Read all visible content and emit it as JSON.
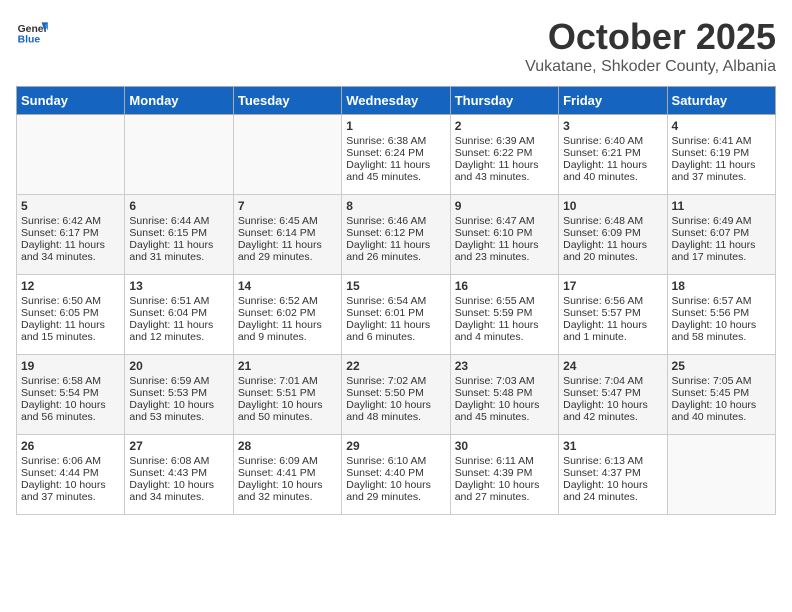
{
  "header": {
    "logo_general": "General",
    "logo_blue": "Blue",
    "month": "October 2025",
    "location": "Vukatane, Shkoder County, Albania"
  },
  "weekdays": [
    "Sunday",
    "Monday",
    "Tuesday",
    "Wednesday",
    "Thursday",
    "Friday",
    "Saturday"
  ],
  "rows": [
    [
      {
        "day": "",
        "info": ""
      },
      {
        "day": "",
        "info": ""
      },
      {
        "day": "",
        "info": ""
      },
      {
        "day": "1",
        "info": "Sunrise: 6:38 AM\nSunset: 6:24 PM\nDaylight: 11 hours and 45 minutes."
      },
      {
        "day": "2",
        "info": "Sunrise: 6:39 AM\nSunset: 6:22 PM\nDaylight: 11 hours and 43 minutes."
      },
      {
        "day": "3",
        "info": "Sunrise: 6:40 AM\nSunset: 6:21 PM\nDaylight: 11 hours and 40 minutes."
      },
      {
        "day": "4",
        "info": "Sunrise: 6:41 AM\nSunset: 6:19 PM\nDaylight: 11 hours and 37 minutes."
      }
    ],
    [
      {
        "day": "5",
        "info": "Sunrise: 6:42 AM\nSunset: 6:17 PM\nDaylight: 11 hours and 34 minutes."
      },
      {
        "day": "6",
        "info": "Sunrise: 6:44 AM\nSunset: 6:15 PM\nDaylight: 11 hours and 31 minutes."
      },
      {
        "day": "7",
        "info": "Sunrise: 6:45 AM\nSunset: 6:14 PM\nDaylight: 11 hours and 29 minutes."
      },
      {
        "day": "8",
        "info": "Sunrise: 6:46 AM\nSunset: 6:12 PM\nDaylight: 11 hours and 26 minutes."
      },
      {
        "day": "9",
        "info": "Sunrise: 6:47 AM\nSunset: 6:10 PM\nDaylight: 11 hours and 23 minutes."
      },
      {
        "day": "10",
        "info": "Sunrise: 6:48 AM\nSunset: 6:09 PM\nDaylight: 11 hours and 20 minutes."
      },
      {
        "day": "11",
        "info": "Sunrise: 6:49 AM\nSunset: 6:07 PM\nDaylight: 11 hours and 17 minutes."
      }
    ],
    [
      {
        "day": "12",
        "info": "Sunrise: 6:50 AM\nSunset: 6:05 PM\nDaylight: 11 hours and 15 minutes."
      },
      {
        "day": "13",
        "info": "Sunrise: 6:51 AM\nSunset: 6:04 PM\nDaylight: 11 hours and 12 minutes."
      },
      {
        "day": "14",
        "info": "Sunrise: 6:52 AM\nSunset: 6:02 PM\nDaylight: 11 hours and 9 minutes."
      },
      {
        "day": "15",
        "info": "Sunrise: 6:54 AM\nSunset: 6:01 PM\nDaylight: 11 hours and 6 minutes."
      },
      {
        "day": "16",
        "info": "Sunrise: 6:55 AM\nSunset: 5:59 PM\nDaylight: 11 hours and 4 minutes."
      },
      {
        "day": "17",
        "info": "Sunrise: 6:56 AM\nSunset: 5:57 PM\nDaylight: 11 hours and 1 minute."
      },
      {
        "day": "18",
        "info": "Sunrise: 6:57 AM\nSunset: 5:56 PM\nDaylight: 10 hours and 58 minutes."
      }
    ],
    [
      {
        "day": "19",
        "info": "Sunrise: 6:58 AM\nSunset: 5:54 PM\nDaylight: 10 hours and 56 minutes."
      },
      {
        "day": "20",
        "info": "Sunrise: 6:59 AM\nSunset: 5:53 PM\nDaylight: 10 hours and 53 minutes."
      },
      {
        "day": "21",
        "info": "Sunrise: 7:01 AM\nSunset: 5:51 PM\nDaylight: 10 hours and 50 minutes."
      },
      {
        "day": "22",
        "info": "Sunrise: 7:02 AM\nSunset: 5:50 PM\nDaylight: 10 hours and 48 minutes."
      },
      {
        "day": "23",
        "info": "Sunrise: 7:03 AM\nSunset: 5:48 PM\nDaylight: 10 hours and 45 minutes."
      },
      {
        "day": "24",
        "info": "Sunrise: 7:04 AM\nSunset: 5:47 PM\nDaylight: 10 hours and 42 minutes."
      },
      {
        "day": "25",
        "info": "Sunrise: 7:05 AM\nSunset: 5:45 PM\nDaylight: 10 hours and 40 minutes."
      }
    ],
    [
      {
        "day": "26",
        "info": "Sunrise: 6:06 AM\nSunset: 4:44 PM\nDaylight: 10 hours and 37 minutes."
      },
      {
        "day": "27",
        "info": "Sunrise: 6:08 AM\nSunset: 4:43 PM\nDaylight: 10 hours and 34 minutes."
      },
      {
        "day": "28",
        "info": "Sunrise: 6:09 AM\nSunset: 4:41 PM\nDaylight: 10 hours and 32 minutes."
      },
      {
        "day": "29",
        "info": "Sunrise: 6:10 AM\nSunset: 4:40 PM\nDaylight: 10 hours and 29 minutes."
      },
      {
        "day": "30",
        "info": "Sunrise: 6:11 AM\nSunset: 4:39 PM\nDaylight: 10 hours and 27 minutes."
      },
      {
        "day": "31",
        "info": "Sunrise: 6:13 AM\nSunset: 4:37 PM\nDaylight: 10 hours and 24 minutes."
      },
      {
        "day": "",
        "info": ""
      }
    ]
  ]
}
